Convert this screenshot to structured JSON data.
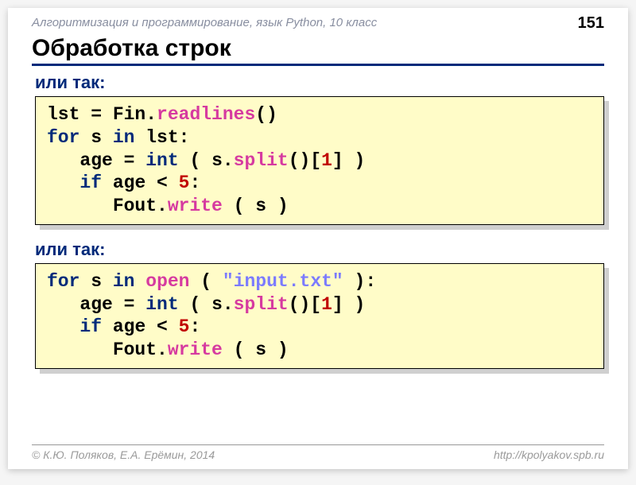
{
  "header": {
    "course": "Алгоритмизация и программирование, язык Python, 10 класс",
    "page": "151"
  },
  "title": "Обработка строк",
  "sub1": "или так:",
  "sub2": "или так:",
  "code1": {
    "l1a": "lst = Fin.",
    "l1b": "readlines",
    "l1c": "()",
    "l2a": "for",
    "l2b": " s ",
    "l2c": "in",
    "l2d": " lst:",
    "l3a": "   age = ",
    "l3b": "int",
    "l3c": " ( s.",
    "l3d": "split",
    "l3e": "()[",
    "l3f": "1",
    "l3g": "] )",
    "l4a": "   ",
    "l4b": "if",
    "l4c": " age < ",
    "l4d": "5",
    "l4e": ":",
    "l5a": "      Fout.",
    "l5b": "write",
    "l5c": " ( s )"
  },
  "code2": {
    "l1a": "for",
    "l1b": " s ",
    "l1c": "in",
    "l1d": " ",
    "l1e": "open",
    "l1f": " ( ",
    "l1g": "\"input.txt\"",
    "l1h": " ):",
    "l2a": "   age = ",
    "l2b": "int",
    "l2c": " ( s.",
    "l2d": "split",
    "l2e": "()[",
    "l2f": "1",
    "l2g": "] )",
    "l3a": "   ",
    "l3b": "if",
    "l3c": " age < ",
    "l3d": "5",
    "l3e": ":",
    "l4a": "      Fout.",
    "l4b": "write",
    "l4c": " ( s )"
  },
  "footer": {
    "left": "© К.Ю. Поляков, Е.А. Ерёмин, 2014",
    "right": "http://kpolyakov.spb.ru"
  }
}
